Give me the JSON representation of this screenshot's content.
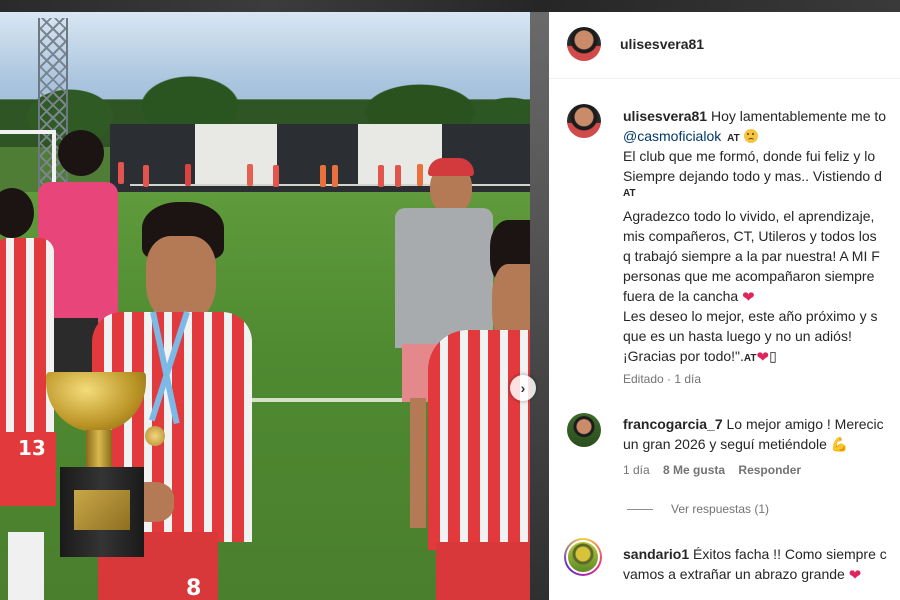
{
  "post": {
    "author": "ulisesvera81",
    "caption": {
      "author": "ulisesvera81",
      "line1": "Hoy lamentablemente me to",
      "mention": "@casmoficialok",
      "mention_suffix": "AT",
      "line2": "El club que me formó, donde fui feliz y lo",
      "line3": "Siempre dejando todo y mas.. Vistiendo d",
      "line3_suffix": "AT",
      "line4": "Agradezco todo lo vivido, el aprendizaje,",
      "line5": "mis compañeros, CT, Utileros y todos los",
      "line6": "q trabajó siempre a la par nuestra! A MI F",
      "line7": "personas que me acompañaron siempre",
      "line8": "fuera de la cancha",
      "line9": "Les deseo lo mejor, este año próximo y s",
      "line10": "que es un hasta luego y no un adiós!",
      "line11": "¡Gracias por todo!\".",
      "line11_suffix": "AT",
      "line11_box": "▯",
      "meta": "Editado · 1 día"
    },
    "photo": {
      "jersey_number_left": "13",
      "jersey_number_center": "8"
    }
  },
  "comments": [
    {
      "username": "francogarcia_7",
      "line1": "Lo mejor amigo ! Merecic",
      "line2": "un gran 2026 y seguí metiéndole",
      "time": "1 día",
      "likes": "8 Me gusta",
      "reply": "Responder",
      "view_replies": "Ver respuestas (1)"
    },
    {
      "username": "sandario1",
      "line1": "Éxitos facha !! Como siempre c",
      "line2": "vamos a extrañar un abrazo grande"
    }
  ],
  "icons": {
    "next": "chevron-right-icon",
    "heart": "heart-emoji",
    "sad": "sad-face-emoji",
    "muscle": "flexed-biceps-emoji"
  },
  "colors": {
    "mention": "#00376b",
    "heart": "#e0245e",
    "meta": "#737373"
  }
}
